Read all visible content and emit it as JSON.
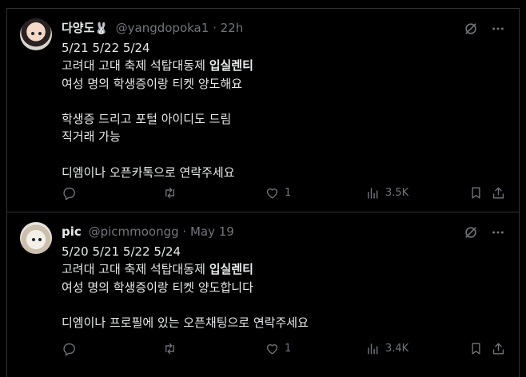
{
  "tweets": [
    {
      "name": "다양도",
      "emoji": "🐰",
      "handle": "@yangdopoka1",
      "separator": "·",
      "time": "22h",
      "lines": [
        {
          "text": "5/21 5/22 5/24"
        },
        {
          "text": "고려대 고대 축제 석탑대동제 ",
          "bold": "입실렌티"
        },
        {
          "text": "여성 명의 학생증이랑 티켓 양도해요"
        },
        {
          "text": ""
        },
        {
          "text": "학생증 드리고 포털 아이디도 드림"
        },
        {
          "text": "직거래 가능"
        },
        {
          "text": ""
        },
        {
          "text": "디엠이나 오픈카톡으로 연락주세요"
        }
      ],
      "replies": "",
      "retweets": "",
      "likes": "1",
      "views": "3.5K"
    },
    {
      "name": "pic",
      "emoji": "",
      "handle": "@picmmoongg",
      "separator": "·",
      "time": "May 19",
      "lines": [
        {
          "text": "5/20 5/21 5/22 5/24"
        },
        {
          "text": "고려대 고대 축제 석탑대동제 ",
          "bold": "입실렌티"
        },
        {
          "text": "여성 명의 학생증이랑 티켓 양도합니다"
        },
        {
          "text": ""
        },
        {
          "text": "디엠이나 프로필에 있는 오픈채팅으로 연락주세요"
        }
      ],
      "replies": "",
      "retweets": "",
      "likes": "1",
      "views": "3.4K"
    }
  ],
  "icons": {
    "grok": "grok-icon",
    "more": "more-icon",
    "reply": "reply-icon",
    "retweet": "retweet-icon",
    "like": "heart-icon",
    "views": "views-icon",
    "bookmark": "bookmark-icon",
    "share": "share-icon"
  },
  "colors": {
    "background": "#000000",
    "text": "#e7e9ea",
    "secondary": "#71767b",
    "border": "#2f3336"
  }
}
